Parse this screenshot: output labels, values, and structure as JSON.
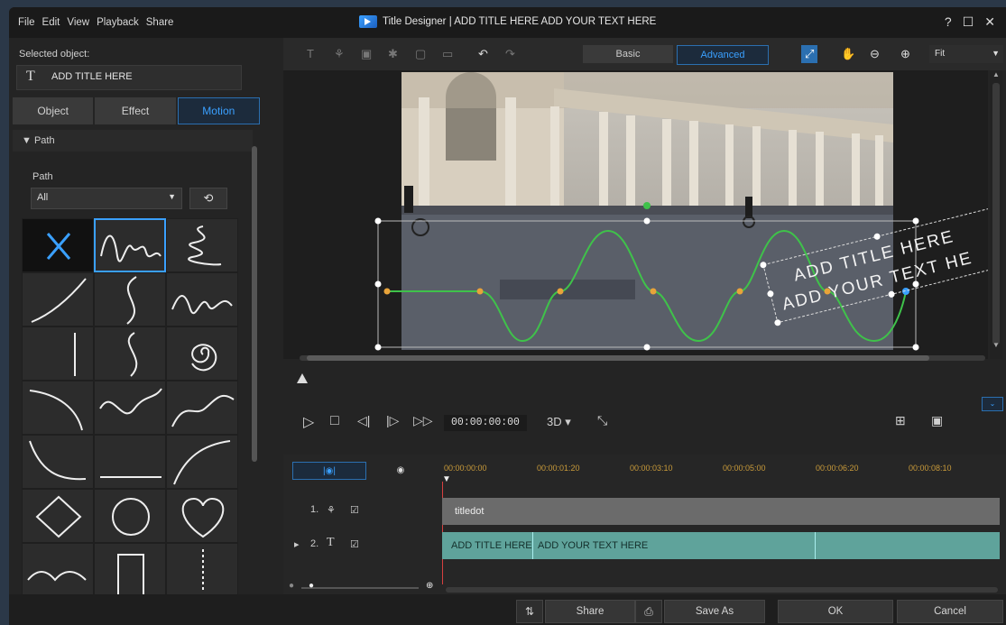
{
  "menu": {
    "file": "File",
    "edit": "Edit",
    "view": "View",
    "playback": "Playback",
    "share": "Share"
  },
  "window": {
    "title": "Title Designer  |  ADD TITLE HERE ADD YOUR TEXT HERE",
    "help": "?",
    "max": "☐",
    "close": "✕"
  },
  "left": {
    "selected_label": "Selected object:",
    "selected_value": "ADD TITLE HERE",
    "selected_icon": "T",
    "tabs": [
      "Object",
      "Effect",
      "Motion"
    ],
    "path_header": "Path",
    "path_label": "Path",
    "path_value": "All"
  },
  "toolbar": {
    "basic": "Basic",
    "advanced": "Advanced",
    "zoom": "Fit"
  },
  "preview": {
    "title_line1": "ADD TITLE HERE",
    "title_line2": "ADD YOUR TEXT HE"
  },
  "playback": {
    "timecode": "00:00:00:00",
    "mode3d": "3D ▾"
  },
  "timeline": {
    "ruler": [
      "00:00:00:00",
      "00:00:01:20",
      "00:00:03:10",
      "00:00:05:00",
      "00:00:06:20",
      "00:00:08:10"
    ],
    "track1_num": "1.",
    "track2_num": "2.",
    "clip1": "titledot",
    "clip2a": "ADD TITLE HERE",
    "clip2b": "ADD YOUR TEXT HERE"
  },
  "buttons": {
    "share": "Share",
    "saveas": "Save As",
    "ok": "OK",
    "cancel": "Cancel"
  },
  "colors": {
    "accent": "#3aa0ff",
    "path_green": "#3fc24a",
    "clip_teal": "#5fa39b"
  }
}
